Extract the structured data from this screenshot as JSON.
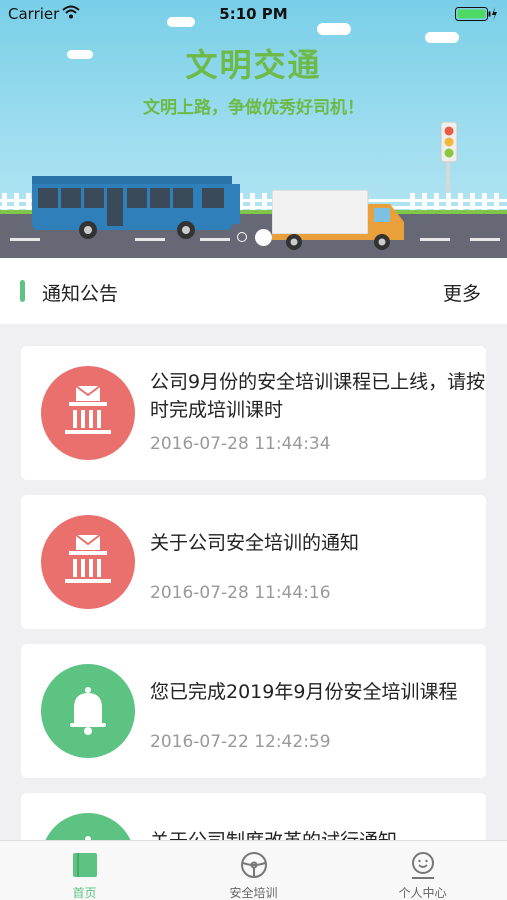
{
  "status_bar": {
    "carrier": "Carrier",
    "time": "5:10 PM"
  },
  "banner": {
    "title": "文明交通",
    "subtitle": "文明上路，争做优秀好司机！",
    "page_count": 2,
    "active_page": 2
  },
  "notices": {
    "header_title": "通知公告",
    "more_label": "更多",
    "items": [
      {
        "title": "公司9月份的安全培训课程已上线，请按时完成培训课时",
        "time": "2016-07-28 11:44:34",
        "icon": "institution-mail-icon",
        "color": "#e9706d"
      },
      {
        "title": "关于公司安全培训的通知",
        "time": "2016-07-28 11:44:16",
        "icon": "institution-mail-icon",
        "color": "#e9706d"
      },
      {
        "title": "您已完成2019年9月份安全培训课程",
        "time": "2016-07-22 12:42:59",
        "icon": "bell-icon",
        "color": "#5dc382"
      },
      {
        "title": "关于公司制度改革的试行通知",
        "time": "",
        "icon": "bell-icon",
        "color": "#5dc382"
      }
    ]
  },
  "tabs": [
    {
      "label": "首页",
      "icon": "home-icon",
      "active": true
    },
    {
      "label": "安全培训",
      "icon": "steering-wheel-icon",
      "active": false
    },
    {
      "label": "个人中心",
      "icon": "user-icon",
      "active": false
    }
  ],
  "colors": {
    "accent": "#5dc382",
    "red_icon": "#e9706d",
    "inactive_tab": "#666666"
  }
}
